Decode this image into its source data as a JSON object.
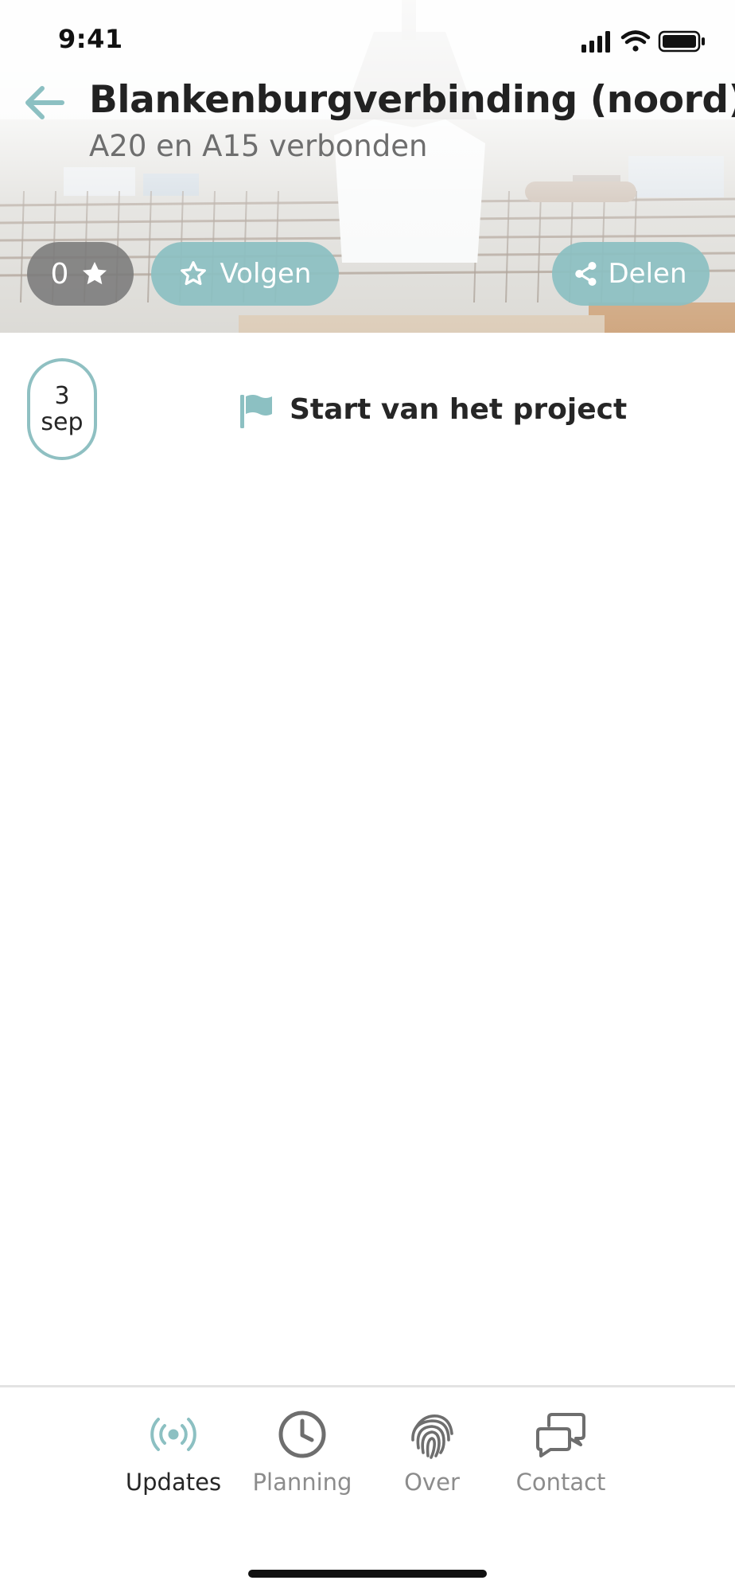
{
  "status_bar": {
    "time": "9:41"
  },
  "header": {
    "title": "Blankenburgverbinding (noord)",
    "subtitle": "A20 en A15 verbonden"
  },
  "actions": {
    "follower_count": "0",
    "follow_label": "Volgen",
    "share_label": "Delen"
  },
  "timeline": [
    {
      "day": "3",
      "month": "sep",
      "title": "Start van het project",
      "icon": "flag-icon"
    }
  ],
  "tab_bar": {
    "active": "Updates",
    "tabs": [
      {
        "label": "Updates",
        "icon": "broadcast-icon"
      },
      {
        "label": "Planning",
        "icon": "clock-icon"
      },
      {
        "label": "Over",
        "icon": "fingerprint-icon"
      },
      {
        "label": "Contact",
        "icon": "chat-bubbles-icon"
      }
    ]
  },
  "colors": {
    "accent": "#8cc0c2",
    "count_pill": "#7a7a7a",
    "text_dark": "#262626",
    "text_muted": "#8c8c8c"
  }
}
